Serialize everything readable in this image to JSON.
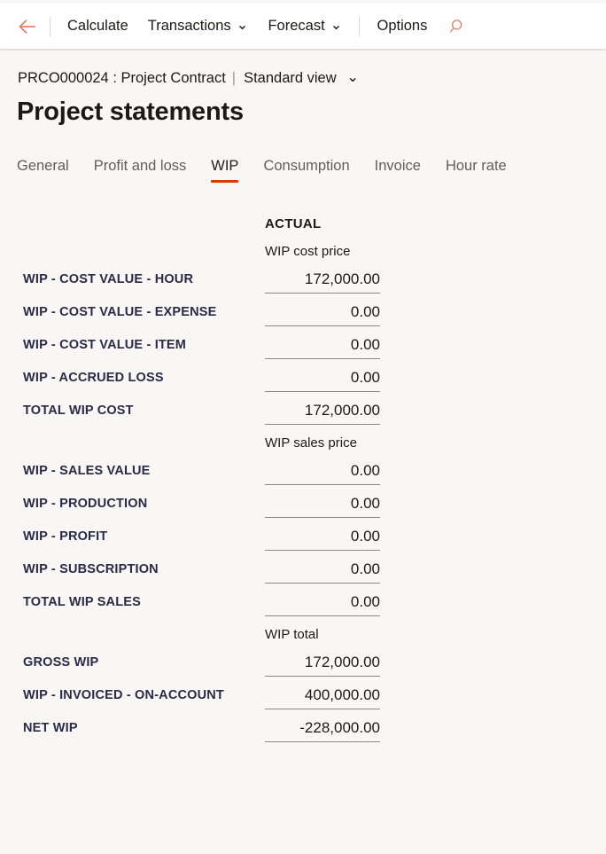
{
  "toolbar": {
    "back_icon": "arrow-left-icon",
    "items": [
      {
        "label": "Calculate",
        "has_chevron": false,
        "separator_before": true
      },
      {
        "label": "Transactions",
        "has_chevron": true,
        "separator_before": false
      },
      {
        "label": "Forecast",
        "has_chevron": true,
        "separator_before": false
      },
      {
        "label": "Options",
        "has_chevron": false,
        "separator_before": true
      }
    ],
    "search_icon": "search-icon",
    "chevron": "⌄"
  },
  "breadcrumb": {
    "record": "PRCO000024 : Project Contract",
    "separator": "|",
    "view": "Standard view",
    "chevron": "⌄"
  },
  "page": {
    "title": "Project statements"
  },
  "tabs": [
    {
      "label": "General",
      "active": false
    },
    {
      "label": "Profit and loss",
      "active": false
    },
    {
      "label": "WIP",
      "active": true
    },
    {
      "label": "Consumption",
      "active": false
    },
    {
      "label": "Invoice",
      "active": false
    },
    {
      "label": "Hour rate",
      "active": false
    }
  ],
  "statement": {
    "column_heading": "ACTUAL",
    "rows": [
      {
        "type": "header-strong",
        "text": "ACTUAL"
      },
      {
        "type": "header",
        "text": "WIP cost price"
      },
      {
        "type": "data",
        "label": "WIP - COST VALUE - HOUR",
        "value": "172,000.00"
      },
      {
        "type": "data",
        "label": "WIP - COST VALUE - EXPENSE",
        "value": "0.00"
      },
      {
        "type": "data",
        "label": "WIP - COST VALUE - ITEM",
        "value": "0.00"
      },
      {
        "type": "data",
        "label": "WIP - ACCRUED LOSS",
        "value": "0.00"
      },
      {
        "type": "data",
        "label": "TOTAL WIP COST",
        "value": "172,000.00"
      },
      {
        "type": "header",
        "text": "WIP sales price"
      },
      {
        "type": "data",
        "label": "WIP - SALES VALUE",
        "value": "0.00"
      },
      {
        "type": "data",
        "label": "WIP - PRODUCTION",
        "value": "0.00"
      },
      {
        "type": "data",
        "label": "WIP - PROFIT",
        "value": "0.00"
      },
      {
        "type": "data",
        "label": "WIP - SUBSCRIPTION",
        "value": "0.00"
      },
      {
        "type": "data",
        "label": "TOTAL WIP SALES",
        "value": "0.00"
      },
      {
        "type": "header",
        "text": "WIP total"
      },
      {
        "type": "data",
        "label": "GROSS WIP",
        "value": "172,000.00"
      },
      {
        "type": "data",
        "label": "WIP - INVOICED - ON-ACCOUNT",
        "value": "400,000.00"
      },
      {
        "type": "data",
        "label": "NET WIP",
        "value": "-228,000.00"
      }
    ]
  },
  "colors": {
    "accent": "#d83b01",
    "page_background": "#f8f7f5",
    "bar_background": "#ffffff",
    "label_text": "#2b2a45",
    "muted_text": "#605e5c"
  }
}
